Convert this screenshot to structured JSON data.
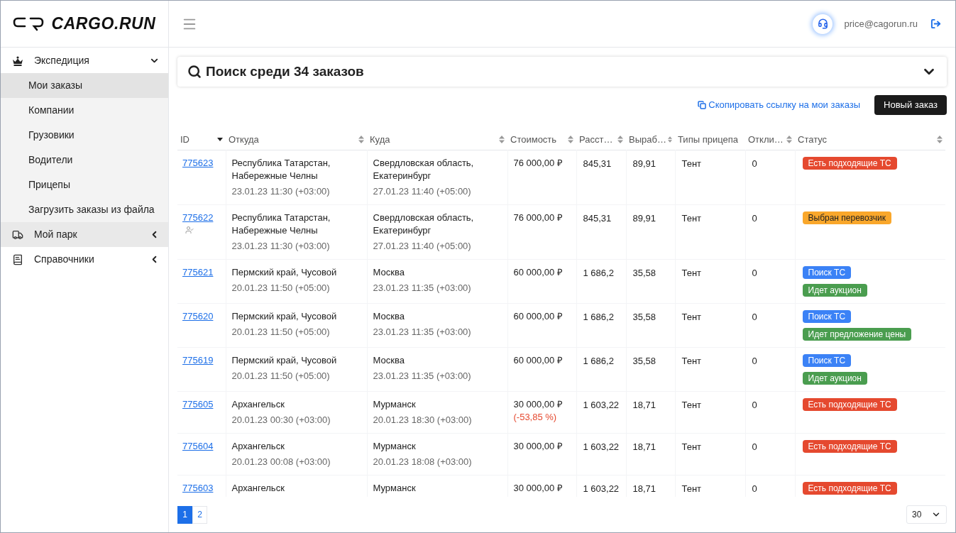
{
  "logo": {
    "text": "CARGO.RUN"
  },
  "sidebar": {
    "items": [
      {
        "label": "Экспедиция",
        "expanded": true,
        "selected": false,
        "children": [
          {
            "label": "Мои заказы",
            "selected": true
          },
          {
            "label": "Компании",
            "selected": false
          },
          {
            "label": "Грузовики",
            "selected": false
          },
          {
            "label": "Водители",
            "selected": false
          },
          {
            "label": "Прицепы",
            "selected": false
          },
          {
            "label": "Загрузить заказы из файла",
            "selected": false
          }
        ]
      },
      {
        "label": "Мой парк",
        "expanded": false,
        "selected": true
      },
      {
        "label": "Справочники",
        "expanded": false,
        "selected": false
      }
    ]
  },
  "header": {
    "user_email": "price@cagorun.ru"
  },
  "search": {
    "title": "Поиск среди 34 заказов",
    "expanded": false
  },
  "actions": {
    "copy_link": "Скопировать ссылку на мои заказы",
    "new_order": "Новый заказ"
  },
  "table": {
    "columns": [
      {
        "label": "ID",
        "sortable": true,
        "sorted": true
      },
      {
        "label": "Откуда",
        "sortable": true,
        "sorted": false
      },
      {
        "label": "Куда",
        "sortable": true,
        "sorted": false
      },
      {
        "label": "Стоимость",
        "sortable": true,
        "sorted": false
      },
      {
        "label": "Расст…",
        "sortable": true,
        "sorted": false
      },
      {
        "label": "Выраб…",
        "sortable": true,
        "sorted": false
      },
      {
        "label": "Типы прицепа",
        "sortable": false
      },
      {
        "label": "Откли…",
        "sortable": true,
        "sorted": false
      },
      {
        "label": "Статус",
        "sortable": true,
        "sorted": false
      }
    ],
    "rows": [
      {
        "id": "775623",
        "carrier_assigned": false,
        "from": {
          "place": "Республика Татарстан, Набережные Челны",
          "time": "23.01.23 11:30 (+03:00)"
        },
        "to": {
          "place": "Свердловская область, Екатеринбург",
          "time": "27.01.23 11:40 (+05:00)"
        },
        "cost": "76 000,00 ₽",
        "distance": "845,31",
        "rate": "89,91",
        "trailer": "Тент",
        "responses": "0",
        "statuses": [
          {
            "label": "Есть подходящие ТС",
            "color": "#e5492f"
          }
        ]
      },
      {
        "id": "775622",
        "carrier_assigned": true,
        "from": {
          "place": "Республика Татарстан, Набережные Челны",
          "time": "23.01.23 11:30 (+03:00)"
        },
        "to": {
          "place": "Свердловская область, Екатеринбург",
          "time": "27.01.23 11:40 (+05:00)"
        },
        "cost": "76 000,00 ₽",
        "distance": "845,31",
        "rate": "89,91",
        "trailer": "Тент",
        "responses": "0",
        "statuses": [
          {
            "label": "Выбран перевозчик",
            "color": "#f9a72b"
          }
        ]
      },
      {
        "id": "775621",
        "carrier_assigned": false,
        "from": {
          "place": "Пермский край, Чусовой",
          "time": "20.01.23 11:50 (+05:00)"
        },
        "to": {
          "place": "Москва",
          "time": "23.01.23 11:35 (+03:00)"
        },
        "cost": "60 000,00 ₽",
        "distance": "1 686,2",
        "rate": "35,58",
        "trailer": "Тент",
        "responses": "0",
        "statuses": [
          {
            "label": "Поиск ТС",
            "color": "#3b82f6"
          },
          {
            "label": "Идет аукцион",
            "color": "#4a9d4f"
          }
        ]
      },
      {
        "id": "775620",
        "carrier_assigned": false,
        "from": {
          "place": "Пермский край, Чусовой",
          "time": "20.01.23 11:50 (+05:00)"
        },
        "to": {
          "place": "Москва",
          "time": "23.01.23 11:35 (+03:00)"
        },
        "cost": "60 000,00 ₽",
        "distance": "1 686,2",
        "rate": "35,58",
        "trailer": "Тент",
        "responses": "0",
        "statuses": [
          {
            "label": "Поиск ТС",
            "color": "#3b82f6"
          },
          {
            "label": "Идет предложение цены",
            "color": "#4a9d4f"
          }
        ]
      },
      {
        "id": "775619",
        "carrier_assigned": false,
        "from": {
          "place": "Пермский край, Чусовой",
          "time": "20.01.23 11:50 (+05:00)"
        },
        "to": {
          "place": "Москва",
          "time": "23.01.23 11:35 (+03:00)"
        },
        "cost": "60 000,00 ₽",
        "distance": "1 686,2",
        "rate": "35,58",
        "trailer": "Тент",
        "responses": "0",
        "statuses": [
          {
            "label": "Поиск ТС",
            "color": "#3b82f6"
          },
          {
            "label": "Идет аукцион",
            "color": "#4a9d4f"
          }
        ]
      },
      {
        "id": "775605",
        "carrier_assigned": false,
        "from": {
          "place": "Архангельск",
          "time": "20.01.23 00:30 (+03:00)"
        },
        "to": {
          "place": "Мурманск",
          "time": "20.01.23 18:30 (+03:00)"
        },
        "cost": "30 000,00 ₽",
        "cost_change": "(-53,85 %)",
        "distance": "1 603,22",
        "rate": "18,71",
        "trailer": "Тент",
        "responses": "0",
        "statuses": [
          {
            "label": "Есть подходящие ТС",
            "color": "#e5492f"
          }
        ]
      },
      {
        "id": "775604",
        "carrier_assigned": false,
        "from": {
          "place": "Архангельск",
          "time": "20.01.23 00:08 (+03:00)"
        },
        "to": {
          "place": "Мурманск",
          "time": "20.01.23 18:08 (+03:00)"
        },
        "cost": "30 000,00 ₽",
        "distance": "1 603,22",
        "rate": "18,71",
        "trailer": "Тент",
        "responses": "0",
        "statuses": [
          {
            "label": "Есть подходящие ТС",
            "color": "#e5492f"
          }
        ]
      },
      {
        "id": "775603",
        "carrier_assigned": false,
        "from": {
          "place": "Архангельск"
        },
        "to": {
          "place": "Мурманск"
        },
        "cost": "30 000,00 ₽",
        "distance": "1 603,22",
        "rate": "18,71",
        "trailer": "Тент",
        "responses": "0",
        "statuses": [
          {
            "label": "Есть подходящие ТС",
            "color": "#e5492f"
          }
        ]
      }
    ]
  },
  "pagination": {
    "pages": [
      {
        "label": "1",
        "selected": true
      },
      {
        "label": "2",
        "selected": false
      }
    ],
    "page_size": "30"
  }
}
